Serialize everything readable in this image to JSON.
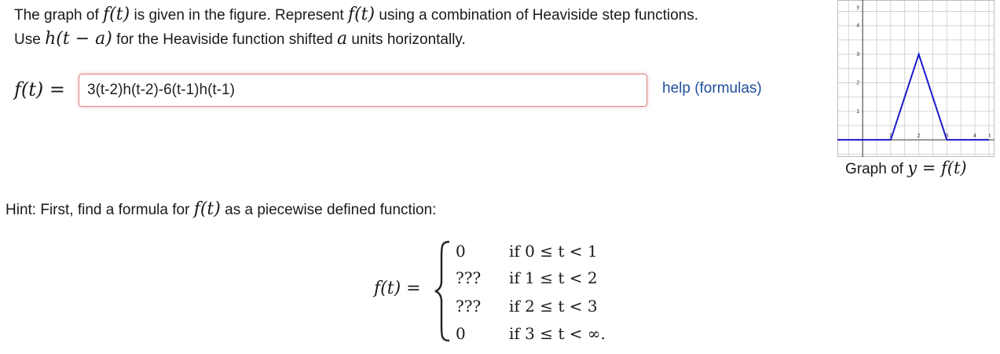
{
  "problem": {
    "text_1": "The graph of ",
    "f_t": "f(t)",
    "text_2": " is given in the figure. Represent ",
    "text_3": " using a combination of Heaviside step functions.",
    "text_4": "Use ",
    "h_expr": "h(t − a)",
    "text_5": " for the Heaviside function shifted ",
    "a_var": "a",
    "text_6": " units horizontally."
  },
  "answer": {
    "label": "f(t) =",
    "value": "3(t-2)h(t-2)-6(t-1)h(t-1)",
    "help_link": "help (formulas)"
  },
  "hint": {
    "text_1": "Hint: First, find a formula for ",
    "f_t": "f(t)",
    "text_2": " as a piecewise defined function:"
  },
  "piecewise": {
    "lhs": "f(t) =",
    "rows": [
      {
        "value": "0",
        "condition": "if 0 ≤ t < 1"
      },
      {
        "value": "???",
        "condition": "if 1 ≤ t < 2"
      },
      {
        "value": "???",
        "condition": "if 2 ≤ t < 3"
      },
      {
        "value": "0",
        "condition": "if 3 ≤ t < ∞."
      }
    ]
  },
  "graph": {
    "y_label": "y",
    "x_label": "t",
    "x_ticks": [
      "1",
      "2",
      "3",
      "4"
    ],
    "y_ticks": [
      "1",
      "2",
      "3",
      "4"
    ],
    "caption_text": "Graph of ",
    "caption_math": "y = f(t)",
    "line_color": "#1a1acc"
  },
  "chart_data": {
    "type": "line",
    "x": [
      0,
      1,
      2,
      3,
      4.5
    ],
    "y": [
      0,
      0,
      3,
      0,
      0
    ],
    "xlim": [
      -0.9,
      4.7
    ],
    "ylim": [
      -0.6,
      4.9
    ],
    "grid": true
  }
}
